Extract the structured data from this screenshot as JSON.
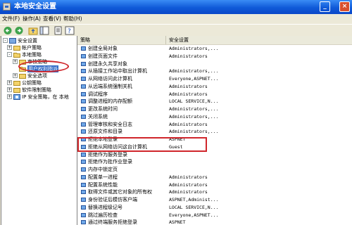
{
  "window": {
    "title": "本地安全设置",
    "controls": {
      "minimize": "_",
      "maximize": "□",
      "close": "×"
    }
  },
  "menu": [
    "文件(F)",
    "操作(A)",
    "查看(V)",
    "帮助(H)"
  ],
  "toolbar": {
    "buttons": [
      "back-icon",
      "forward-icon",
      "up-folder-icon",
      "show-tree-icon",
      "export-icon",
      "help-icon"
    ]
  },
  "tree": {
    "items": [
      {
        "label": "安全设置",
        "icon": "security-icon",
        "expander": "-"
      },
      {
        "label": "帐户策略",
        "icon": "folder-icon",
        "expander": "+"
      },
      {
        "label": "本地策略",
        "icon": "folder-open-icon",
        "expander": "-"
      },
      {
        "label": "审核策略",
        "icon": "folder-icon",
        "expander": "+"
      },
      {
        "label": "用户权利指派",
        "icon": "folder-open-icon",
        "expander": ""
      },
      {
        "label": "安全选项",
        "icon": "folder-icon",
        "expander": "+"
      },
      {
        "label": "公钥策略",
        "icon": "folder-icon",
        "expander": "+"
      },
      {
        "label": "软件限制策略",
        "icon": "folder-icon",
        "expander": "+"
      },
      {
        "label": "IP 安全策略，在 本地",
        "icon": "ip-policy-icon",
        "expander": "+"
      }
    ]
  },
  "list": {
    "columns": [
      "策略",
      "安全设置"
    ],
    "rows": [
      {
        "policy": "创建全局对象",
        "setting": "Administrators,..."
      },
      {
        "policy": "创建页面文件",
        "setting": "Administrators"
      },
      {
        "policy": "创建永久共享对象",
        "setting": ""
      },
      {
        "policy": "从插接工作站中取出计算机",
        "setting": "Administrators,..."
      },
      {
        "policy": "从网络访问此计算机",
        "setting": "Everyone,ASPNET..."
      },
      {
        "policy": "从远端系统强制关机",
        "setting": "Administrators"
      },
      {
        "policy": "调试程序",
        "setting": "Administrators"
      },
      {
        "policy": "调整进程的内存配额",
        "setting": "LOCAL SERVICE,N..."
      },
      {
        "policy": "更改系统时间",
        "setting": "Administrators,..."
      },
      {
        "policy": "关闭系统",
        "setting": "Administrators,..."
      },
      {
        "policy": "管理审核和安全日志",
        "setting": "Administrators"
      },
      {
        "policy": "还原文件和目录",
        "setting": "Administrators,..."
      },
      {
        "policy": "拒绝本地登录",
        "setting": "ASPNET"
      },
      {
        "policy": "拒绝从网络访问这台计算机",
        "setting": "Guest"
      },
      {
        "policy": "拒绝作为服务登录",
        "setting": ""
      },
      {
        "policy": "拒绝作为批作业登录",
        "setting": ""
      },
      {
        "policy": "内存中锁定页",
        "setting": ""
      },
      {
        "policy": "配置单一进程",
        "setting": "Administrators"
      },
      {
        "policy": "配置系统性能",
        "setting": "Administrators"
      },
      {
        "policy": "取得文件或其它对象的所有权",
        "setting": "Administrators"
      },
      {
        "policy": "身份验证后模仿客户端",
        "setting": "ASPNET,Administ..."
      },
      {
        "policy": "替换进程级记号",
        "setting": "LOCAL SERVICE,N..."
      },
      {
        "policy": "跳过遍历检查",
        "setting": "Everyone,ASPNET..."
      },
      {
        "policy": "通过终端服务拒绝登录",
        "setting": "ASPNET"
      }
    ]
  },
  "annotation_color": "#d0262b"
}
